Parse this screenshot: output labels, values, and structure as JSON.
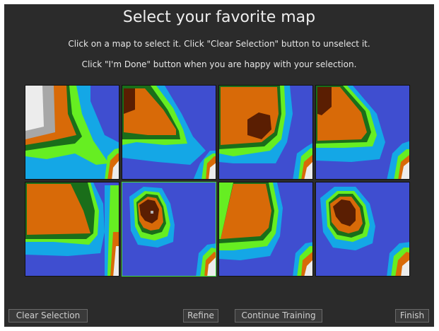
{
  "title": "Select your favorite map",
  "instructions": {
    "line1": "Click on a map to select it. Click \"Clear Selection\" button to unselect it.",
    "line2": "Click \"I'm Done\" button when you are happy with your selection."
  },
  "colors": {
    "panel": "#2b2b2b",
    "deep_blue": "#3f4ed0",
    "light_blue": "#14a7e6",
    "green": "#66ee22",
    "dark_green": "#1a6e1a",
    "orange": "#d86a08",
    "brown": "#5a1e02",
    "gray": "#a7a7a7",
    "white": "#ececec",
    "selection": "#3ddc3d"
  },
  "maps": [
    {
      "id": "map-1",
      "selected": false
    },
    {
      "id": "map-2",
      "selected": false
    },
    {
      "id": "map-3",
      "selected": false
    },
    {
      "id": "map-4",
      "selected": false
    },
    {
      "id": "map-5",
      "selected": false
    },
    {
      "id": "map-6",
      "selected": true
    },
    {
      "id": "map-7",
      "selected": false
    },
    {
      "id": "map-8",
      "selected": false
    }
  ],
  "buttons": {
    "clear_selection": "Clear Selection",
    "refine": "Refine",
    "continue_training": "Continue Training",
    "finish": "Finish"
  }
}
